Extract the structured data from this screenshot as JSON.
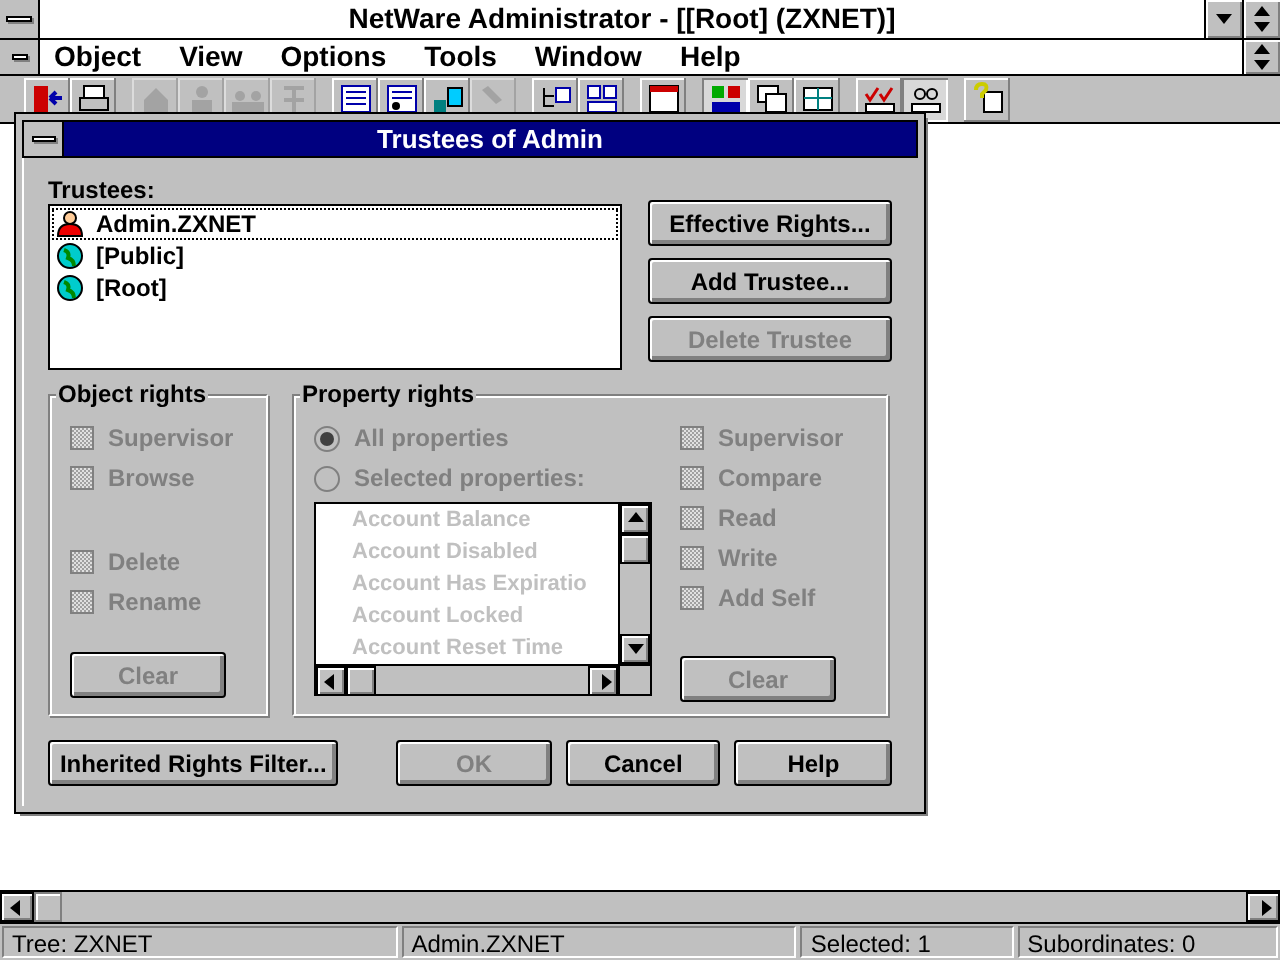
{
  "window": {
    "title": "NetWare Administrator - [[Root] (ZXNET)]"
  },
  "menu": [
    "Object",
    "View",
    "Options",
    "Tools",
    "Window",
    "Help"
  ],
  "toolbar": [
    [
      {
        "disabled": false,
        "pressed": false
      },
      {
        "disabled": false,
        "pressed": false
      }
    ],
    [
      {
        "disabled": true,
        "pressed": false
      },
      {
        "disabled": true,
        "pressed": false
      },
      {
        "disabled": true,
        "pressed": false
      },
      {
        "disabled": true,
        "pressed": false
      }
    ],
    [
      {
        "disabled": false,
        "pressed": false
      },
      {
        "disabled": false,
        "pressed": false
      },
      {
        "disabled": false,
        "pressed": false
      },
      {
        "disabled": true,
        "pressed": false
      }
    ],
    [
      {
        "disabled": false,
        "pressed": false
      },
      {
        "disabled": false,
        "pressed": false
      }
    ],
    [
      {
        "disabled": false,
        "pressed": false
      }
    ],
    [
      {
        "disabled": false,
        "pressed": true
      },
      {
        "disabled": false,
        "pressed": false
      },
      {
        "disabled": false,
        "pressed": false
      }
    ],
    [
      {
        "disabled": false,
        "pressed": false
      },
      {
        "disabled": false,
        "pressed": true
      }
    ],
    [
      {
        "disabled": false,
        "pressed": false
      }
    ]
  ],
  "dialog": {
    "title": "Trustees of Admin",
    "trustees_label": "Trustees:",
    "trustees": [
      {
        "name": "Admin.ZXNET",
        "kind": "user",
        "selected": true
      },
      {
        "name": "[Public]",
        "kind": "globe",
        "selected": false
      },
      {
        "name": "[Root]",
        "kind": "globe",
        "selected": false
      }
    ],
    "side_buttons": [
      {
        "label": "Effective Rights...",
        "disabled": false
      },
      {
        "label": "Add Trustee...",
        "disabled": false
      },
      {
        "label": "Delete Trustee",
        "disabled": true
      }
    ],
    "object_rights": {
      "title": "Object rights",
      "groups": [
        [
          {
            "label": "Supervisor",
            "checked": false,
            "disabled": true
          },
          {
            "label": "Browse",
            "checked": false,
            "disabled": true
          }
        ],
        [
          {
            "label": "Delete",
            "checked": false,
            "disabled": true
          },
          {
            "label": "Rename",
            "checked": false,
            "disabled": true
          }
        ]
      ],
      "clear": {
        "label": "Clear",
        "disabled": true
      }
    },
    "property_rights": {
      "title": "Property rights",
      "radios": [
        {
          "label": "All properties",
          "selected": true,
          "disabled": true
        },
        {
          "label": "Selected properties:",
          "selected": false,
          "disabled": true
        }
      ],
      "properties": [
        "Account Balance",
        "Account Disabled",
        "Account Has Expiratio",
        "Account Locked",
        "Account Reset Time"
      ],
      "checks": [
        {
          "label": "Supervisor",
          "checked": false,
          "disabled": true
        },
        {
          "label": "Compare",
          "checked": false,
          "disabled": true
        },
        {
          "label": "Read",
          "checked": false,
          "disabled": true
        },
        {
          "label": "Write",
          "checked": false,
          "disabled": true
        },
        {
          "label": "Add Self",
          "checked": false,
          "disabled": true
        }
      ],
      "clear": {
        "label": "Clear",
        "disabled": true
      }
    },
    "buttons": [
      {
        "label": "Inherited Rights Filter...",
        "disabled": false
      },
      {
        "label": "OK",
        "disabled": true
      },
      {
        "label": "Cancel",
        "disabled": false
      },
      {
        "label": "Help",
        "disabled": false
      }
    ]
  },
  "status_bar": [
    "Tree: ZXNET",
    "Admin.ZXNET",
    "Selected: 1",
    "Subordinates: 0"
  ]
}
